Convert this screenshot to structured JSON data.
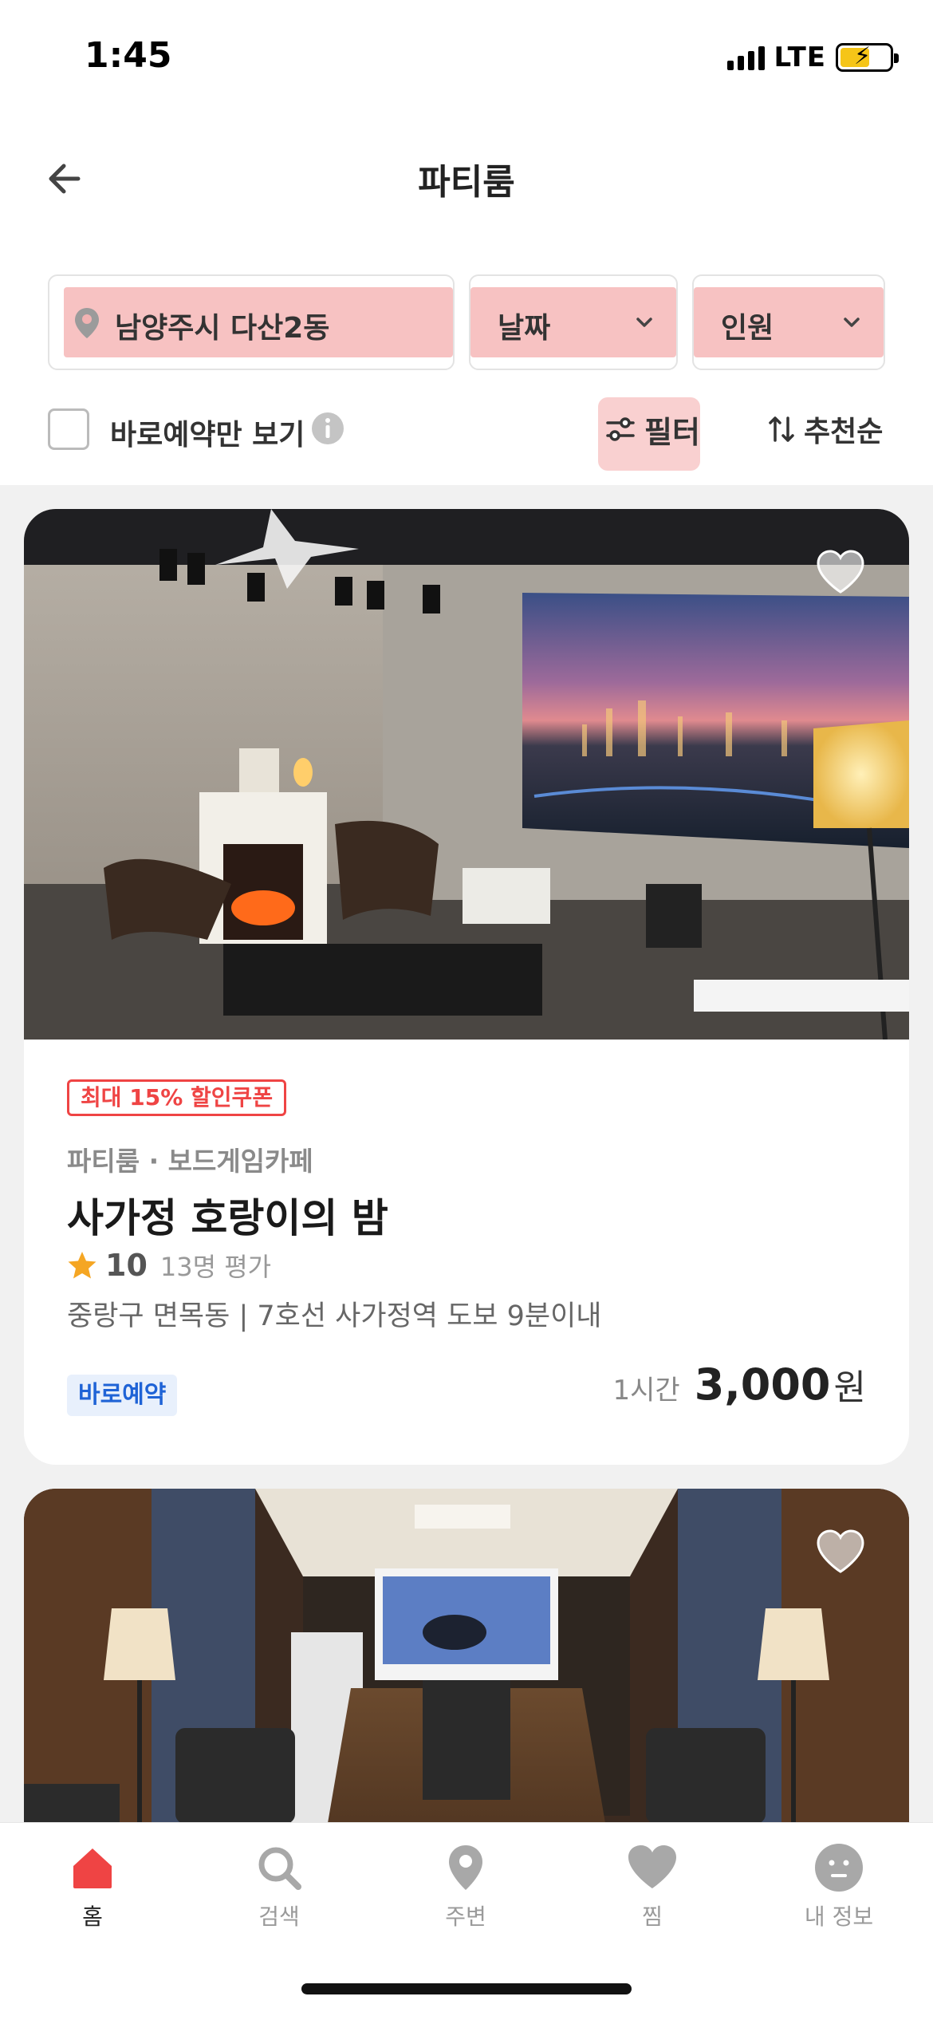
{
  "status_bar": {
    "time": "1:45",
    "network": "LTE"
  },
  "header": {
    "title": "파티룸"
  },
  "search": {
    "location": "남양주시 다산2동",
    "date_label": "날짜",
    "guests_label": "인원"
  },
  "filter_bar": {
    "instant_only_label": "바로예약만 보기",
    "instant_only_checked": false,
    "filter_label": "필터",
    "sort_label": "추천순"
  },
  "listings": [
    {
      "coupon": "최대 15% 할인쿠폰",
      "category": "파티룸 · 보드게임카페",
      "title": "사가정 호랑이의 밤",
      "rating": "10",
      "review_count": "13명 평가",
      "address": "중랑구 면목동 | 7호선 사가정역 도보 9분이내",
      "badge": "바로예약",
      "price_unit": "1시간",
      "price": "3,000",
      "currency": "원",
      "favorited": false
    },
    {
      "favorited": false
    }
  ],
  "tabbar": {
    "items": [
      {
        "label": "홈",
        "icon": "home-icon",
        "active": true
      },
      {
        "label": "검색",
        "icon": "search-icon",
        "active": false
      },
      {
        "label": "주변",
        "icon": "location-pin-icon",
        "active": false
      },
      {
        "label": "찜",
        "icon": "heart-icon",
        "active": false
      },
      {
        "label": "내 정보",
        "icon": "profile-face-icon",
        "active": false
      }
    ]
  },
  "colors": {
    "accent": "#ef4444",
    "badge_text": "#1f63d6",
    "badge_bg": "#e8f0fc",
    "star": "#f5a623",
    "highlight": "#ee7878"
  }
}
